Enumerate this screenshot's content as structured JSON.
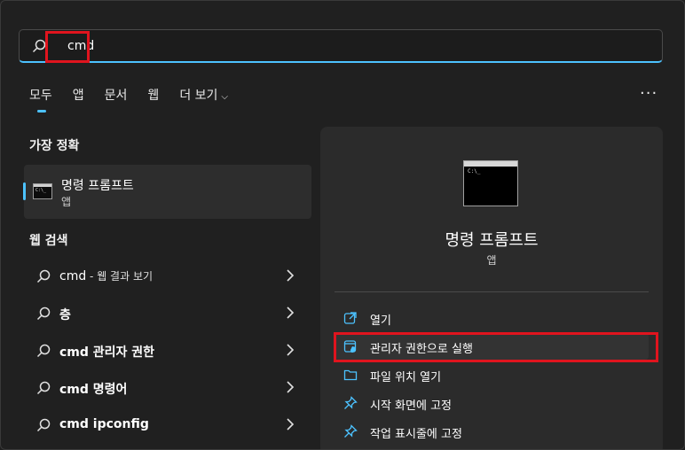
{
  "search": {
    "value": "cmd"
  },
  "tabs": [
    {
      "label": "모두"
    },
    {
      "label": "앱"
    },
    {
      "label": "문서"
    },
    {
      "label": "웹"
    },
    {
      "label": "더 보기"
    }
  ],
  "best_match": {
    "section_title": "가장 정확",
    "title": "명령 프롬프트",
    "subtitle": "앱"
  },
  "web_search": {
    "section_title": "웹 검색",
    "items": [
      {
        "query": "cmd",
        "suffix": " - 웹 결과 보기"
      },
      {
        "query": "층",
        "suffix": ""
      },
      {
        "query": "cmd 관리자 권한",
        "suffix": ""
      },
      {
        "query": "cmd 명령어",
        "suffix": ""
      },
      {
        "query": "cmd ipconfig",
        "suffix": ""
      }
    ]
  },
  "detail": {
    "title": "명령 프롬프트",
    "subtitle": "앱",
    "actions": [
      {
        "label": "열기",
        "icon": "open-external-icon"
      },
      {
        "label": "관리자 권한으로 실행",
        "icon": "shield-run-icon"
      },
      {
        "label": "파일 위치 열기",
        "icon": "folder-icon"
      },
      {
        "label": "시작 화면에 고정",
        "icon": "pin-icon"
      },
      {
        "label": "작업 표시줄에 고정",
        "icon": "pin-icon"
      }
    ]
  },
  "colors": {
    "accent": "#4cc2ff",
    "highlight": "#e0141e",
    "background": "#202020",
    "panel": "#2b2b2b"
  }
}
